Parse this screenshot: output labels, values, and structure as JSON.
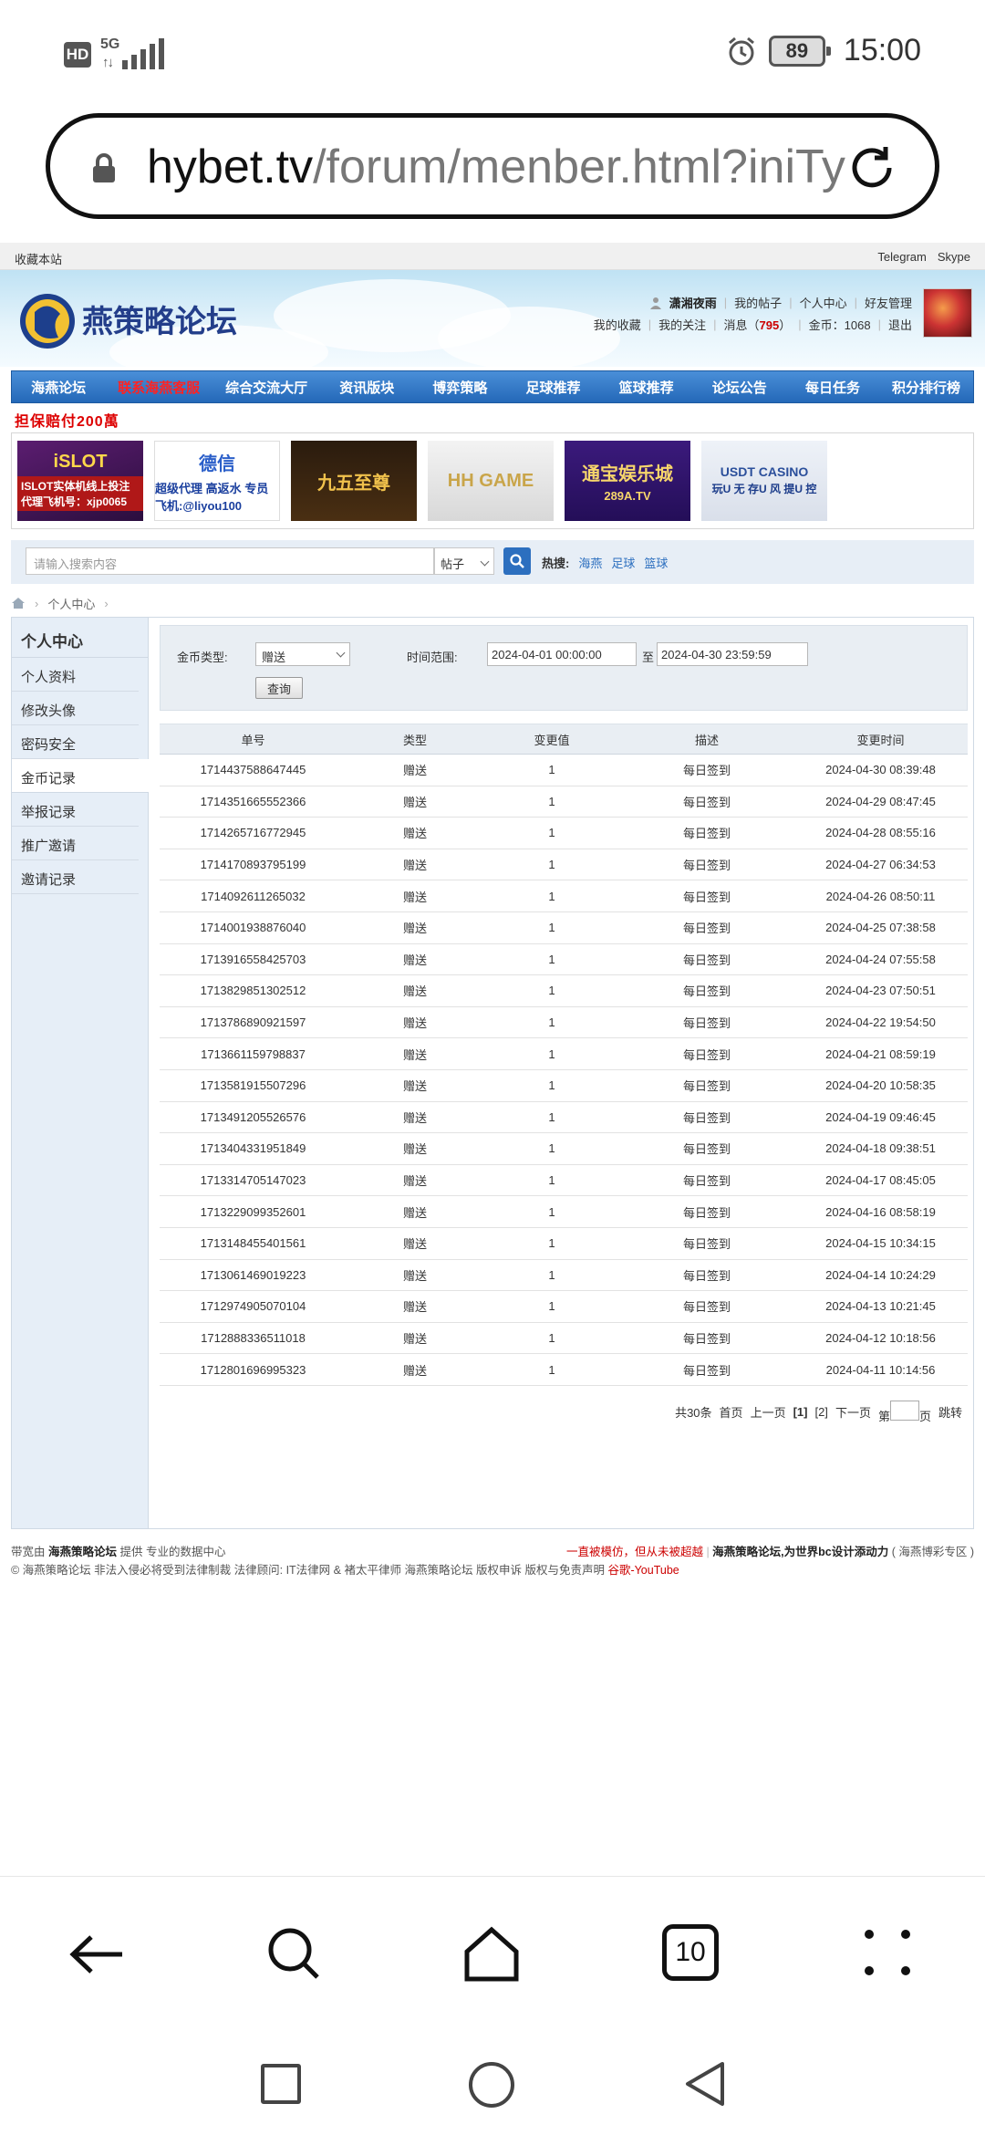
{
  "status_bar": {
    "hd": "HD",
    "network": "5G",
    "signal_arrows": "↑↓",
    "battery": "89",
    "time": "15:00"
  },
  "browser": {
    "url_domain": "hybet.tv",
    "url_path": "/forum/menber.html?iniTy",
    "tab_count": "10"
  },
  "topbar": {
    "favorite": "收藏本站",
    "links": [
      "Telegram",
      "Skype"
    ]
  },
  "header": {
    "user_name": "潇湘夜雨",
    "links1": [
      "我的帖子",
      "个人中心",
      "好友管理"
    ],
    "links2a": [
      "我的收藏",
      "我的关注"
    ],
    "msg_label": "消息（",
    "msg_count": "795",
    "msg_close": "）",
    "coins_label": "金币：",
    "coins": "1068",
    "logout": "退出"
  },
  "nav": {
    "items": [
      "海燕论坛",
      "联系海燕客服",
      "综合交流大厅",
      "资讯版块",
      "博弈策略",
      "足球推荐",
      "篮球推荐",
      "论坛公告",
      "每日任务",
      "积分排行榜"
    ]
  },
  "promo": {
    "title": "担保赔付200萬"
  },
  "ads": [
    {
      "t1": "iSLOT",
      "t2": "ISLOT实体机线上投注 代理飞机号：xjp0065"
    },
    {
      "t1": "德信",
      "t2": "超级代理 高返水 专员飞机:@liyou100"
    },
    {
      "t1": "九五至尊",
      "t2": ""
    },
    {
      "t1": "HH GAME",
      "t2": ""
    },
    {
      "t1": "通宝娱乐城",
      "t2": "289A.TV"
    },
    {
      "t1": "USDT CASINO",
      "t2": "玩U 无 存U 风 提U 控"
    }
  ],
  "search": {
    "placeholder": "请输入搜索内容",
    "type": "帖子",
    "hot_label": "热搜:",
    "hot": [
      "海燕",
      "足球",
      "篮球"
    ]
  },
  "breadcrumb": {
    "current": "个人中心"
  },
  "sidebar": {
    "title": "个人中心",
    "items": [
      "个人资料",
      "修改头像",
      "密码安全",
      "金币记录",
      "举报记录",
      "推广邀请",
      "邀请记录"
    ]
  },
  "filter": {
    "coin_type_label": "金币类型:",
    "coin_type": "赠送",
    "time_label": "时间范围:",
    "date_from": "2024-04-01 00:00:00",
    "to": "至",
    "date_to": "2024-04-30 23:59:59",
    "query": "查询"
  },
  "table": {
    "headers": [
      "单号",
      "类型",
      "变更值",
      "描述",
      "变更时间"
    ],
    "rows": [
      [
        "1714437588647445",
        "赠送",
        "1",
        "每日签到",
        "2024-04-30 08:39:48"
      ],
      [
        "1714351665552366",
        "赠送",
        "1",
        "每日签到",
        "2024-04-29 08:47:45"
      ],
      [
        "1714265716772945",
        "赠送",
        "1",
        "每日签到",
        "2024-04-28 08:55:16"
      ],
      [
        "1714170893795199",
        "赠送",
        "1",
        "每日签到",
        "2024-04-27 06:34:53"
      ],
      [
        "1714092611265032",
        "赠送",
        "1",
        "每日签到",
        "2024-04-26 08:50:11"
      ],
      [
        "1714001938876040",
        "赠送",
        "1",
        "每日签到",
        "2024-04-25 07:38:58"
      ],
      [
        "1713916558425703",
        "赠送",
        "1",
        "每日签到",
        "2024-04-24 07:55:58"
      ],
      [
        "1713829851302512",
        "赠送",
        "1",
        "每日签到",
        "2024-04-23 07:50:51"
      ],
      [
        "1713786890921597",
        "赠送",
        "1",
        "每日签到",
        "2024-04-22 19:54:50"
      ],
      [
        "1713661159798837",
        "赠送",
        "1",
        "每日签到",
        "2024-04-21 08:59:19"
      ],
      [
        "1713581915507296",
        "赠送",
        "1",
        "每日签到",
        "2024-04-20 10:58:35"
      ],
      [
        "1713491205526576",
        "赠送",
        "1",
        "每日签到",
        "2024-04-19 09:46:45"
      ],
      [
        "1713404331951849",
        "赠送",
        "1",
        "每日签到",
        "2024-04-18 09:38:51"
      ],
      [
        "1713314705147023",
        "赠送",
        "1",
        "每日签到",
        "2024-04-17 08:45:05"
      ],
      [
        "1713229099352601",
        "赠送",
        "1",
        "每日签到",
        "2024-04-16 08:58:19"
      ],
      [
        "1713148455401561",
        "赠送",
        "1",
        "每日签到",
        "2024-04-15 10:34:15"
      ],
      [
        "1713061469019223",
        "赠送",
        "1",
        "每日签到",
        "2024-04-14 10:24:29"
      ],
      [
        "1712974905070104",
        "赠送",
        "1",
        "每日签到",
        "2024-04-13 10:21:45"
      ],
      [
        "1712888336511018",
        "赠送",
        "1",
        "每日签到",
        "2024-04-12 10:18:56"
      ],
      [
        "1712801696995323",
        "赠送",
        "1",
        "每日签到",
        "2024-04-11 10:14:56"
      ]
    ]
  },
  "pager": {
    "total": "共30条",
    "first": "首页",
    "prev": "上一页",
    "page1": "[1]",
    "page2": "[2]",
    "next": "下一页",
    "go_pre": "第",
    "go_post": "页",
    "jump": "跳转"
  },
  "footer": {
    "l1": "带宽由",
    "l1b": "海燕策略论坛",
    "l1c": "提供 专业的数据中心",
    "r_red": "一直被模仿，但从未被超越",
    "r_bold": "海燕策略论坛,为世界bc设计添动力",
    "r_tail": "( 海燕博彩专区 )",
    "row2": "© 海燕策略论坛 非法入侵必将受到法律制裁 法律顾问: IT法律网 & 褚太平律师",
    "row2_links": [
      "海燕策略论坛",
      "版权申诉",
      "版权与免责声明"
    ],
    "row2_red": "谷歌-YouTube"
  },
  "colors": {
    "nav_blue": "#2468b8",
    "accent_red": "#cc0000",
    "link_blue": "#2c6fbf"
  }
}
